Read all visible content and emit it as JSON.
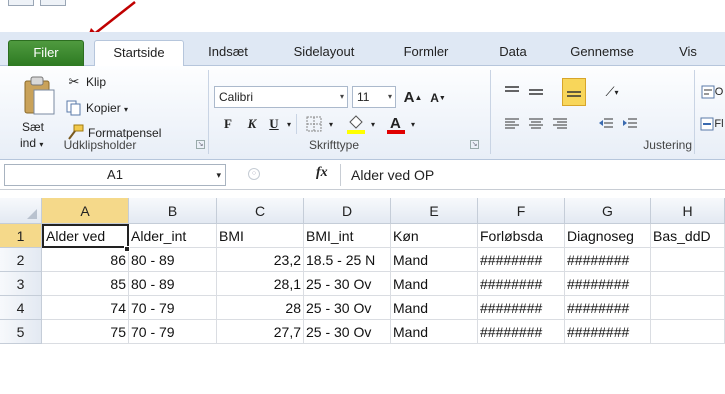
{
  "tabs": [
    {
      "label": "Filer"
    },
    {
      "label": "Startside"
    },
    {
      "label": "Indsæt"
    },
    {
      "label": "Sidelayout"
    },
    {
      "label": "Formler"
    },
    {
      "label": "Data"
    },
    {
      "label": "Gennemse"
    },
    {
      "label": "Vis"
    }
  ],
  "clipboard": {
    "paste_label_line1": "Sæt",
    "paste_label_line2": "ind",
    "cut_label": "Klip",
    "copy_label": "Kopier",
    "format_painter_label": "Formatpensel",
    "group_label": "Udklipsholder"
  },
  "font": {
    "name": "Calibri",
    "size": "11",
    "bold": "F",
    "italic": "K",
    "underline": "U",
    "group_label": "Skrifttype"
  },
  "alignment": {
    "group_label": "Justering"
  },
  "formula_bar": {
    "name_box": "A1",
    "fx": "fx",
    "content": "Alder ved OP"
  },
  "columns": [
    "A",
    "B",
    "C",
    "D",
    "E",
    "F",
    "G",
    "H"
  ],
  "rows": [
    {
      "num": "1",
      "cells": [
        "Alder ved",
        "Alder_int",
        "BMI",
        "BMI_int",
        "Køn",
        "Forløbsda",
        "Diagnoseg",
        "Bas_ddD"
      ]
    },
    {
      "num": "2",
      "cells": [
        "86",
        "80 - 89",
        "23,2",
        "18.5 - 25 N",
        "Mand",
        "########",
        "########",
        ""
      ]
    },
    {
      "num": "3",
      "cells": [
        "85",
        "80 - 89",
        "28,1",
        "25 - 30 Ov",
        "Mand",
        "########",
        "########",
        ""
      ]
    },
    {
      "num": "4",
      "cells": [
        "74",
        "70 - 79",
        "28",
        "25 - 30 Ov",
        "Mand",
        "########",
        "########",
        ""
      ]
    },
    {
      "num": "5",
      "cells": [
        "75",
        "70 - 79",
        "27,7",
        "25 - 30 Ov",
        "Mand",
        "########",
        "########",
        ""
      ]
    }
  ],
  "colors": {
    "file_tab": "#2d7a22",
    "selected_header": "#f5d98a",
    "annotation_arrow": "#c00000"
  }
}
